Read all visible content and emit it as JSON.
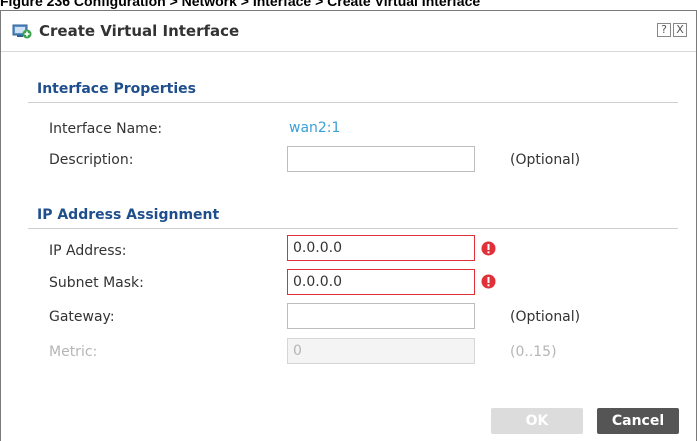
{
  "caption": "Figure 236   Configuration > Network > Interface > Create Virtual Interface",
  "dialog": {
    "title": "Create Virtual Interface",
    "help_label": "?",
    "close_label": "X"
  },
  "interface_properties": {
    "heading": "Interface Properties",
    "name_label": "Interface Name:",
    "name_value": "wan2:1",
    "description_label": "Description:",
    "description_value": "",
    "description_hint": "(Optional)"
  },
  "ip_assignment": {
    "heading": "IP Address Assignment",
    "ip_label": "IP Address:",
    "ip_value": "0.0.0.0",
    "subnet_label": "Subnet Mask:",
    "subnet_value": "0.0.0.0",
    "gateway_label": "Gateway:",
    "gateway_value": "",
    "gateway_hint": "(Optional)",
    "metric_label": "Metric:",
    "metric_value": "0",
    "metric_hint": "(0..15)"
  },
  "footer": {
    "ok_label": "OK",
    "cancel_label": "Cancel"
  },
  "colors": {
    "section_heading": "#1f4e8c",
    "link": "#3aa0d8",
    "error": "#e0303a"
  }
}
